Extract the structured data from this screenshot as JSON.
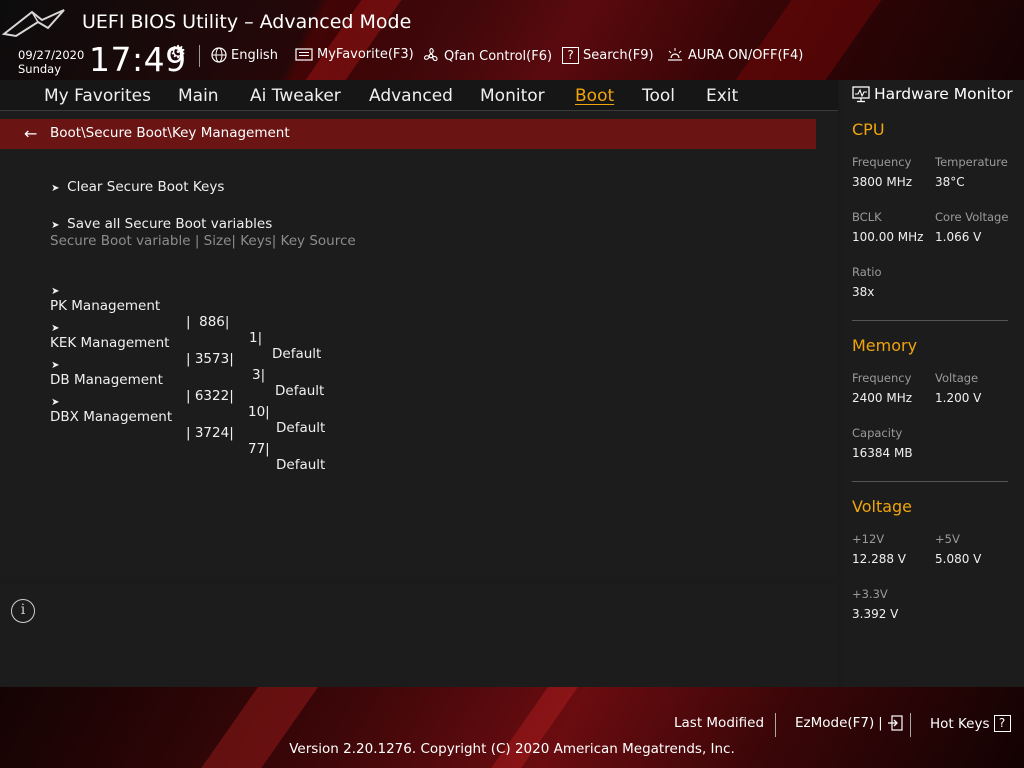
{
  "header": {
    "title": "UEFI BIOS Utility – Advanced Mode",
    "date": "09/27/2020",
    "day": "Sunday",
    "time": "17:49",
    "tools": [
      {
        "label": "English",
        "icon": "globe-icon"
      },
      {
        "label": "MyFavorite(F3)",
        "icon": "favorite-list-icon"
      },
      {
        "label": "Qfan Control(F6)",
        "icon": "fan-icon"
      },
      {
        "label": "Search(F9)",
        "icon": "search-help-icon"
      },
      {
        "label": "AURA ON/OFF(F4)",
        "icon": "aura-light-icon"
      }
    ]
  },
  "nav": {
    "tabs": [
      "My Favorites",
      "Main",
      "Ai Tweaker",
      "Advanced",
      "Monitor",
      "Boot",
      "Tool",
      "Exit"
    ],
    "active": "Boot"
  },
  "main": {
    "breadcrumb": "Boot\\Secure Boot\\Key Management",
    "actions": [
      "Clear Secure Boot Keys",
      "Save all Secure Boot variables"
    ],
    "table_header": "Secure Boot variable | Size| Keys| Key Source",
    "rows": [
      {
        "name": "PK Management",
        "size": "|  886|",
        "keys": "1|",
        "source": "Default"
      },
      {
        "name": "KEK Management",
        "size": "| 3573|",
        "keys": "3|",
        "source": "Default"
      },
      {
        "name": "DB Management",
        "size": "| 6322|",
        "keys": "10|",
        "source": "Default"
      },
      {
        "name": "DBX Management",
        "size": "| 3724|",
        "keys": "77|",
        "source": "Default"
      }
    ]
  },
  "hardware_monitor": {
    "title": "Hardware Monitor",
    "cpu": {
      "heading": "CPU",
      "frequency_label": "Frequency",
      "frequency": "3800 MHz",
      "temperature_label": "Temperature",
      "temperature": "38°C",
      "bclk_label": "BCLK",
      "bclk": "100.00 MHz",
      "core_voltage_label": "Core Voltage",
      "core_voltage": "1.066 V",
      "ratio_label": "Ratio",
      "ratio": "38x"
    },
    "memory": {
      "heading": "Memory",
      "frequency_label": "Frequency",
      "frequency": "2400 MHz",
      "voltage_label": "Voltage",
      "voltage": "1.200 V",
      "capacity_label": "Capacity",
      "capacity": "16384 MB"
    },
    "voltage": {
      "heading": "Voltage",
      "v12_label": "+12V",
      "v12": "12.288 V",
      "v5_label": "+5V",
      "v5": "5.080 V",
      "v33_label": "+3.3V",
      "v33": "3.392 V"
    }
  },
  "footer": {
    "last_modified": "Last Modified",
    "ezmode": "EzMode(F7)",
    "hot_keys": "Hot Keys",
    "hot_keys_key": "?",
    "version": "Version 2.20.1276. Copyright (C) 2020 American Megatrends, Inc."
  },
  "colors": {
    "accent": "#f0a50c",
    "breadcrumb_bg": "#6b1414",
    "panel_bg": "#1c1c1c"
  }
}
